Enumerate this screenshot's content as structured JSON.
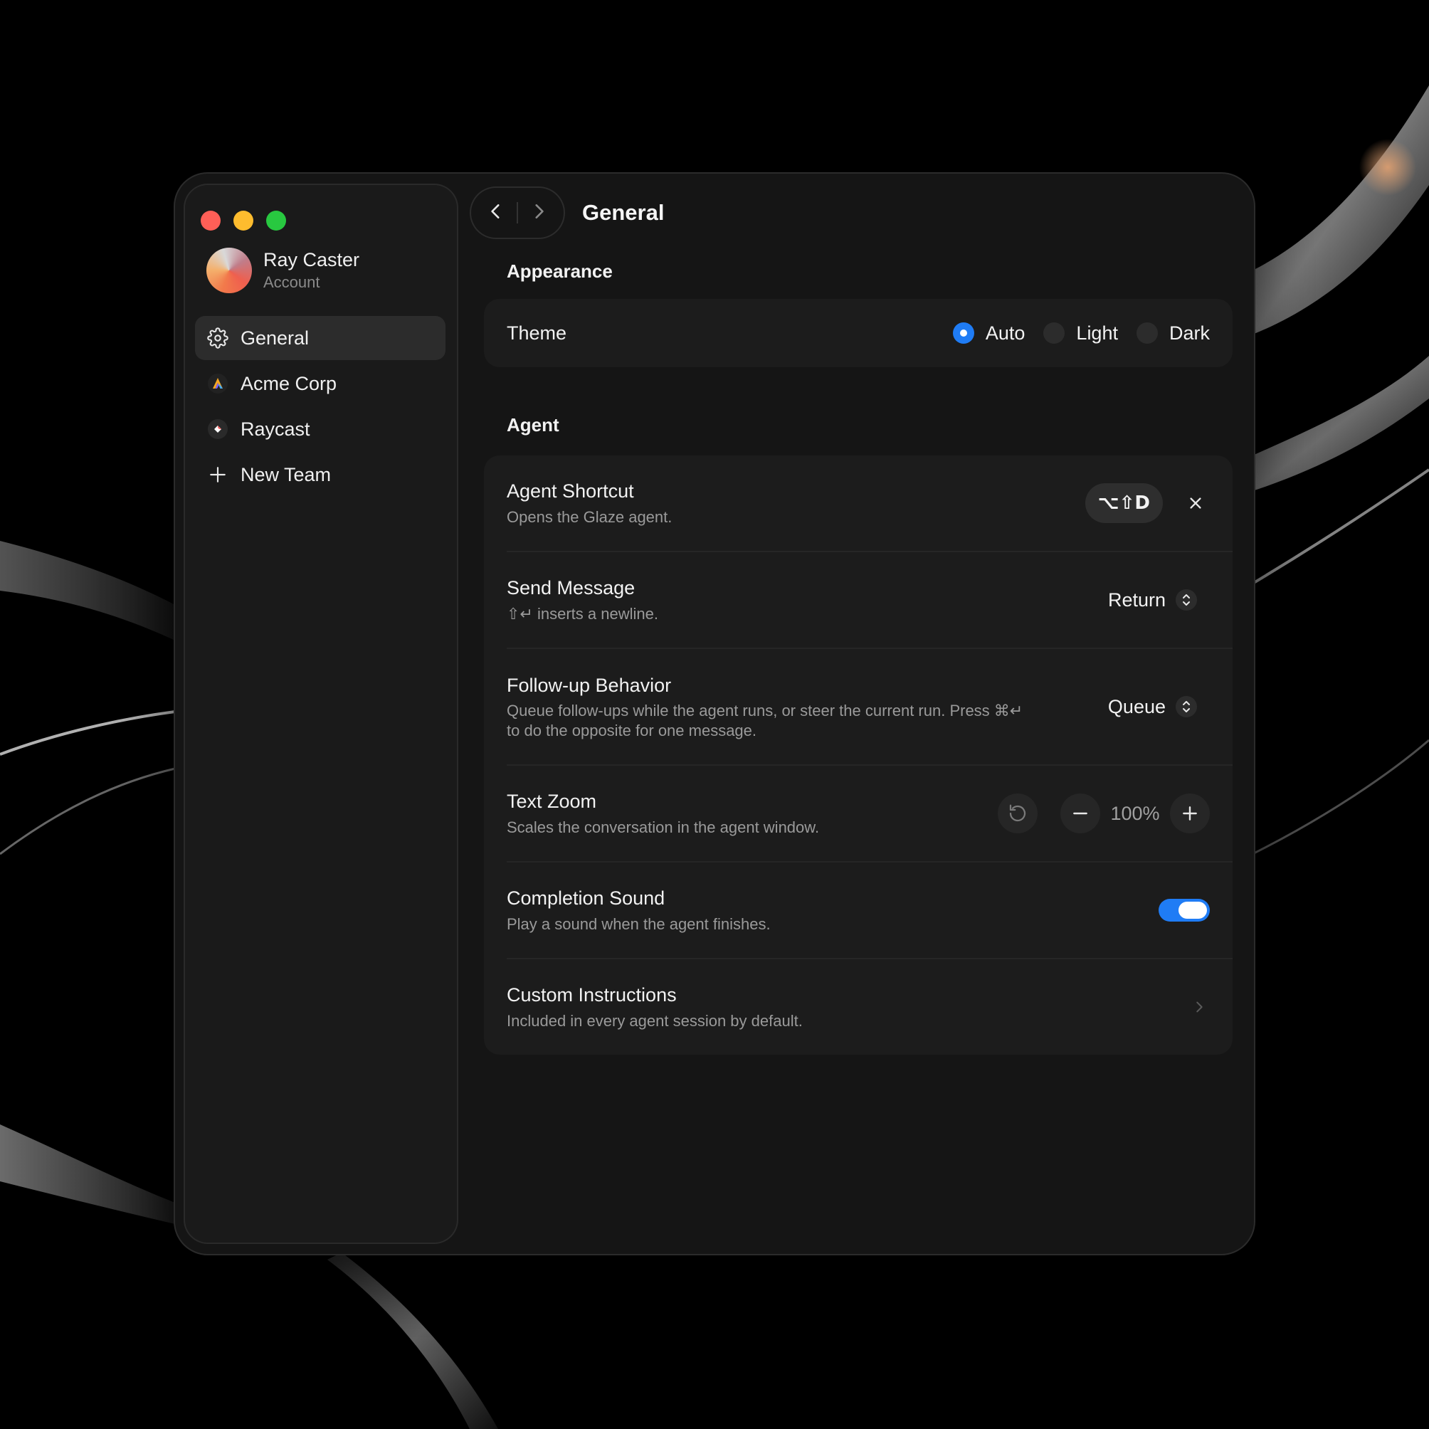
{
  "window": {
    "title": "General",
    "traffic_lights": [
      "#ff5f57",
      "#febc2e",
      "#28c840"
    ]
  },
  "sidebar": {
    "account": {
      "name": "Ray Caster",
      "subtitle": "Account"
    },
    "items": [
      {
        "label": "General",
        "icon": "gear-icon",
        "active": true
      },
      {
        "label": "Acme Corp",
        "icon": "acme-logo-icon",
        "active": false
      },
      {
        "label": "Raycast",
        "icon": "raycast-logo-icon",
        "active": false
      },
      {
        "label": "New Team",
        "icon": "plus-icon",
        "active": false
      }
    ]
  },
  "sections": {
    "appearance": {
      "title": "Appearance",
      "theme": {
        "label": "Theme",
        "options": [
          "Auto",
          "Light",
          "Dark"
        ],
        "selected": "Auto"
      }
    },
    "agent": {
      "title": "Agent",
      "shortcut": {
        "title": "Agent Shortcut",
        "desc": "Opens the Glaze agent.",
        "keys": "⌥⇧D"
      },
      "send_message": {
        "title": "Send Message",
        "desc": "⇧↵ inserts a newline.",
        "value": "Return"
      },
      "follow_up": {
        "title": "Follow-up Behavior",
        "desc_line1": "Queue follow-ups while the agent runs, or steer the current run. Press ⌘↵",
        "desc_line2": "to do the opposite for one message.",
        "value": "Queue"
      },
      "text_zoom": {
        "title": "Text Zoom",
        "desc": "Scales the conversation in the agent window.",
        "value": "100%"
      },
      "completion_sound": {
        "title": "Completion Sound",
        "desc": "Play a sound when the agent finishes.",
        "enabled": true
      },
      "custom_instructions": {
        "title": "Custom Instructions",
        "desc": "Included in every agent session by default."
      }
    }
  },
  "colors": {
    "accent": "#1f7cf5",
    "window_bg": "#151515",
    "card_bg": "#1c1c1c"
  }
}
